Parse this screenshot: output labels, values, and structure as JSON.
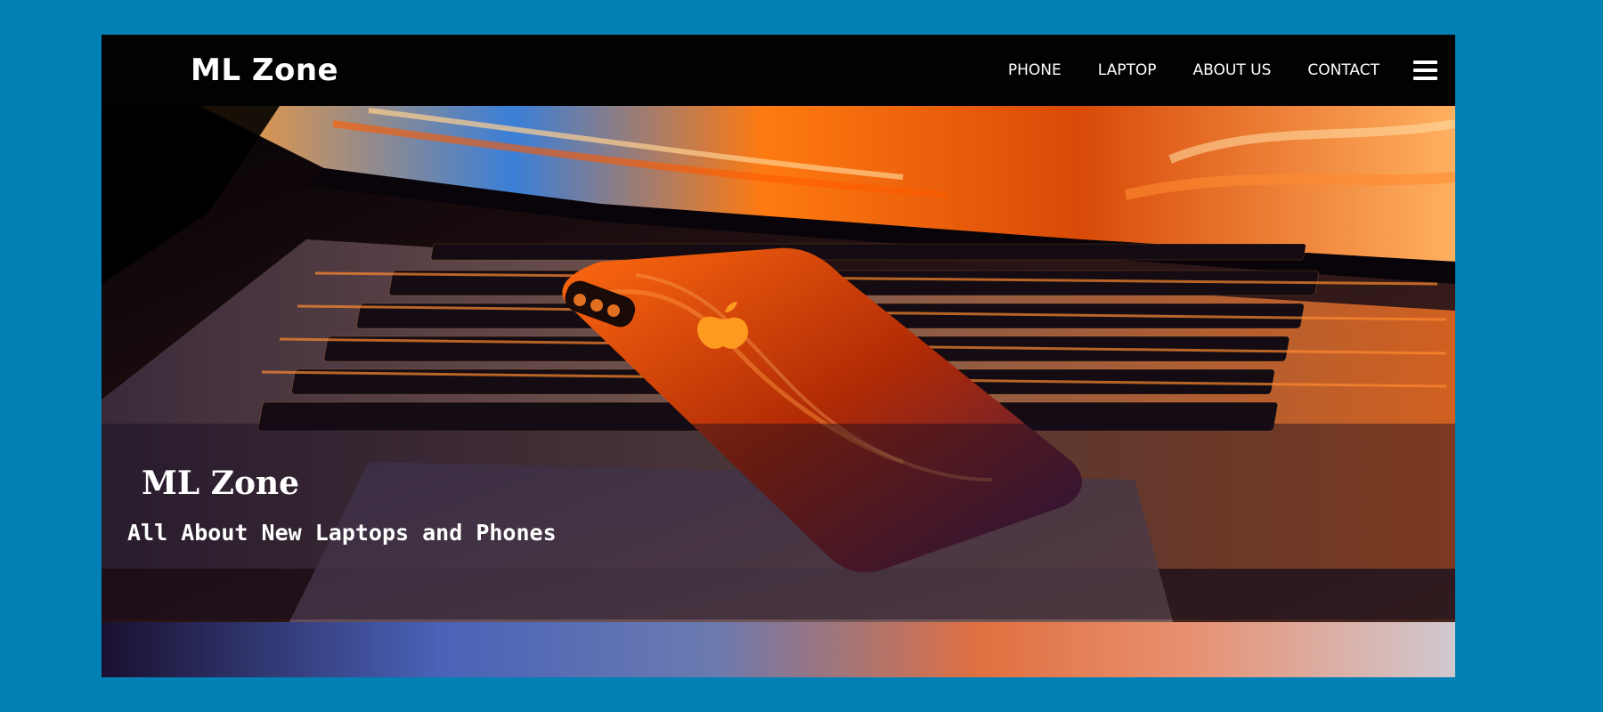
{
  "navbar": {
    "brand": "ML Zone",
    "links": [
      "PHONE",
      "LAPTOP",
      "ABOUT US",
      "CONTACT"
    ],
    "menu_icon": "hamburger-menu-icon"
  },
  "hero": {
    "image": "laptop-and-phone-photo",
    "title": "ML Zone",
    "subtitle": "All About New Laptops and Phones"
  },
  "colors": {
    "page_background": "#0180b5",
    "navbar_background": "#020202",
    "text": "#ffffff",
    "accent_orange": "#ff7a1a"
  }
}
